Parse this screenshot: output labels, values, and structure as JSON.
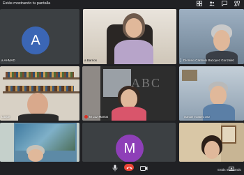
{
  "top_bar": {
    "share_status": "Estás mostrando tu pantalla",
    "icons": [
      "grid-layout-icon",
      "people-icon",
      "chat-icon",
      "activities-icon"
    ]
  },
  "tiles": {
    "t1": {
      "name": "a AHMAD",
      "avatar_letter": "A",
      "avatar_color": "#3b66b5"
    },
    "t2": {
      "name": "a Barrios"
    },
    "t3": {
      "name": "Dionisio Carmelo Bazquez Gonzalez"
    },
    "t4": {
      "name": "Luque"
    },
    "t5": {
      "name": "M Luz Martos",
      "badge_color": "#d93025"
    },
    "t6": {
      "name": "manuel morales ortiz"
    },
    "t8": {
      "avatar_letter": "M",
      "avatar_color": "#8e3fb8"
    }
  },
  "watermark": "ABC",
  "bottom_bar": {
    "present_label": "Estás mostrando",
    "icons": [
      "microphone-icon",
      "hang-up-icon",
      "camera-icon",
      "present-icon"
    ]
  },
  "colors": {
    "background": "#202124",
    "hangup": "#ea4335",
    "tile": "#3c4043"
  }
}
